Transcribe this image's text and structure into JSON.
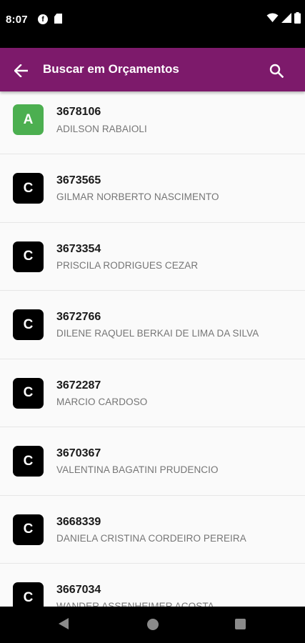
{
  "status_bar": {
    "time": "8:07",
    "notification_icon": "f-circle-icon"
  },
  "app_bar": {
    "title": "Buscar em Orçamentos",
    "background_color": "#7d1a6b"
  },
  "colors": {
    "badge_a": "#4caf50",
    "badge_c": "#000000"
  },
  "items": [
    {
      "badge": "A",
      "code": "3678106",
      "name": "ADILSON RABAIOLI"
    },
    {
      "badge": "C",
      "code": "3673565",
      "name": "GILMAR NORBERTO NASCIMENTO"
    },
    {
      "badge": "C",
      "code": "3673354",
      "name": "PRISCILA RODRIGUES CEZAR"
    },
    {
      "badge": "C",
      "code": "3672766",
      "name": "DILENE RAQUEL BERKAI DE LIMA DA SILVA"
    },
    {
      "badge": "C",
      "code": "3672287",
      "name": "MARCIO CARDOSO"
    },
    {
      "badge": "C",
      "code": "3670367",
      "name": "VALENTINA BAGATINI PRUDENCIO"
    },
    {
      "badge": "C",
      "code": "3668339",
      "name": "DANIELA CRISTINA CORDEIRO PEREIRA"
    },
    {
      "badge": "C",
      "code": "3667034",
      "name": "WANDER ASSENHEIMER ACOSTA"
    }
  ]
}
